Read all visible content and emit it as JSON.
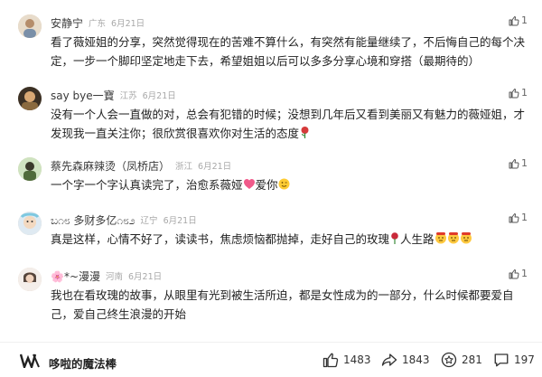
{
  "comments": [
    {
      "username": "安静宁",
      "location": "广东",
      "date": "6月21日",
      "likes": "1",
      "lines": [
        "看了薇娅姐的分享，突然觉得现在的苦难不算什么，有突然有能量继续了，不后悔自己的每个决",
        "定，一步一个脚印坚定地走下去，希望姐姐以后可以多多分享心境和穿搭（最期待的）"
      ]
    },
    {
      "username": "say bye一寶",
      "location": "江苏",
      "date": "6月21日",
      "likes": "1",
      "lines": [
        "没有一个人会一直做的对，总会有犯错的时候；没想到几年后又看到美丽又有魅力的薇娅姐，才",
        "发现我一直关注你；很欣赏很喜欢你对生活的态度"
      ]
    },
    {
      "username": "蔡先森麻辣烫（凤桥店）",
      "location": "浙江",
      "date": "6月21日",
      "likes": "1",
      "lines": [
        "一个字一个字认真读完了，治愈系薇娅",
        "爱你"
      ]
    },
    {
      "username": "ಬ೧೮ 多财多亿೧೮೨",
      "location": "辽宁",
      "date": "6月21日",
      "likes": "1",
      "lines": [
        "真是这样，心情不好了，读读书，焦虑烦恼都抛掉，走好自己的玫瑰",
        "人生路"
      ]
    },
    {
      "username": "🌸*~漫漫",
      "location": "河南",
      "date": "6月21日",
      "likes": "1",
      "lines": [
        "我也在看玫瑰的故事，从眼里有光到被生活所迫，都是女性成为的一部分，什么时候都要爱自",
        "己，爱自己终生浪漫的开始"
      ]
    }
  ],
  "bottom_bar": {
    "brand_name": "哆啦的魔法棒",
    "like_count": "1483",
    "share_count": "1843",
    "fav_count": "281",
    "comment_count": "197"
  },
  "icons": {
    "like": "thumbs-up-icon",
    "share": "share-arrow-icon",
    "favorite": "star-icon",
    "comment": "comment-bubble-icon",
    "brand": "w-logo-icon"
  },
  "colors": {
    "text": "#222222",
    "meta": "#a8a8a8",
    "divider": "#f0f0f0"
  }
}
